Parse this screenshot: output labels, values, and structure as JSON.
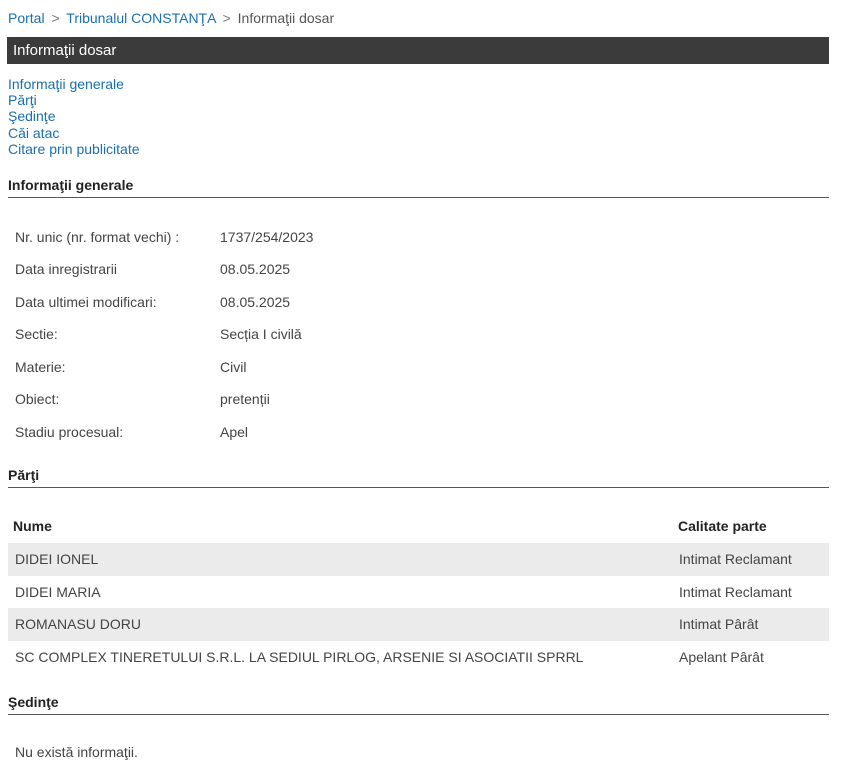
{
  "breadcrumb": {
    "items": [
      "Portal",
      "Tribunalul CONSTANŢA"
    ],
    "current": "Informaţii dosar",
    "separator": ">"
  },
  "page_title": "Informaţii dosar",
  "nav": {
    "links": [
      "Informaţii generale",
      "Părţi",
      "Şedinţe",
      "Căi atac",
      "Citare prin publicitate"
    ]
  },
  "general": {
    "heading": "Informaţii generale",
    "rows": [
      {
        "label": "Nr. unic (nr. format vechi) :",
        "value": "1737/254/2023"
      },
      {
        "label": "Data inregistrarii",
        "value": "08.05.2025"
      },
      {
        "label": "Data ultimei modificari:",
        "value": "08.05.2025"
      },
      {
        "label": "Sectie:",
        "value": "Secția I civilă"
      },
      {
        "label": "Materie:",
        "value": "Civil"
      },
      {
        "label": "Obiect:",
        "value": "pretenții"
      },
      {
        "label": "Stadiu procesual:",
        "value": "Apel"
      }
    ]
  },
  "parties": {
    "heading": "Părţi",
    "columns": [
      "Nume",
      "Calitate parte"
    ],
    "rows": [
      {
        "name": "DIDEI IONEL",
        "role": "Intimat Reclamant"
      },
      {
        "name": "DIDEI MARIA",
        "role": "Intimat Reclamant"
      },
      {
        "name": "ROMANASU DORU",
        "role": "Intimat Pârât"
      },
      {
        "name": "SC COMPLEX TINERETULUI S.R.L. LA SEDIUL PIRLOG, ARSENIE SI ASOCIATII SPRRL",
        "role": "Apelant Pârât"
      }
    ]
  },
  "hearings": {
    "heading": "Şedinţe",
    "empty_text": "Nu există informaţii."
  },
  "colors": {
    "link": "#1a6fb0",
    "title_bar": "#3b3b3b",
    "row_alt": "#ebebeb"
  }
}
